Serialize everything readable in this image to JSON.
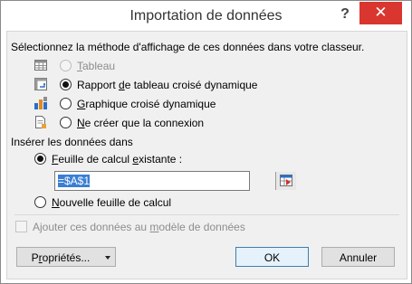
{
  "dialog": {
    "title": "Importation de données",
    "help_label": "?",
    "close_label": "✕"
  },
  "display": {
    "heading": "Sélectionnez la méthode d'affichage de ces données dans votre classeur.",
    "options": [
      {
        "pre": "",
        "mn": "T",
        "post": "ableau",
        "checked": false,
        "enabled": false
      },
      {
        "pre": "Rapport ",
        "mn": "d",
        "post": "e tableau croisé dynamique",
        "checked": true,
        "enabled": true
      },
      {
        "pre": "",
        "mn": "G",
        "post": "raphique croisé dynamique",
        "checked": false,
        "enabled": true
      },
      {
        "pre": "",
        "mn": "N",
        "post": "e créer que la connexion",
        "checked": false,
        "enabled": true
      }
    ],
    "icons": [
      "table-icon",
      "pivot-table-icon",
      "pivot-chart-icon",
      "connection-icon"
    ]
  },
  "insert": {
    "heading": "Insérer les données dans",
    "existing": {
      "pre": "",
      "mn": "F",
      "post": "euille de calcul ",
      "mn2": "e",
      "post2": "xistante :",
      "checked": true
    },
    "range_value": "=$A$1",
    "new_sheet": {
      "pre": "",
      "mn": "N",
      "post": "ouvelle feuille de calcul",
      "checked": false
    }
  },
  "model_checkbox": {
    "pre": "Ajouter ces données au ",
    "mn": "m",
    "post": "odèle de données",
    "checked": false,
    "enabled": false
  },
  "buttons": {
    "properties": {
      "pre": "P",
      "mn": "r",
      "post": "opriétés..."
    },
    "ok": "OK",
    "cancel": "Annuler"
  },
  "colors": {
    "close_bg": "#d9362f",
    "selection": "#3a7fd4",
    "default_border": "#3c7fb1"
  }
}
